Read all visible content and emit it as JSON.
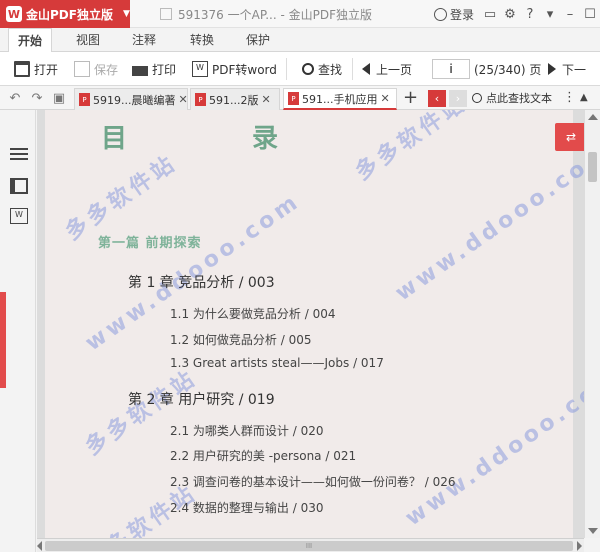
{
  "app": {
    "logo_text": "W",
    "name": "金山PDF独立版",
    "doc_title": "591376 一个AP... - 金山PDF独立版",
    "login_label": "登录"
  },
  "menu": {
    "tabs": [
      "开始",
      "视图",
      "注释",
      "转换",
      "保护"
    ],
    "active": "开始"
  },
  "toolbar": {
    "open": "打开",
    "save": "保存",
    "print": "打印",
    "pdf_to_word": "PDF转word",
    "find": "查找",
    "prev_page": "上一页",
    "page_value": "i",
    "page_count": "(25/340) 页",
    "next_page": "下一"
  },
  "doc_tabs": [
    {
      "label": "5919...晨曦编著",
      "icon": "pdf-icon"
    },
    {
      "label": "591...2版",
      "icon": "pdf-icon"
    },
    {
      "label": "591...手机应用",
      "icon": "pdf-icon"
    }
  ],
  "find_text": "点此查找文本",
  "colors": {
    "accent": "#d63a3a",
    "toc_green": "#6fa58a",
    "watermark": "#7a8cdc"
  },
  "document": {
    "toc_title": "目 录",
    "part": "第一篇 前期探索",
    "entries": [
      {
        "type": "chapter",
        "text": "第 1 章  竞品分析   /   003"
      },
      {
        "type": "section",
        "text": "1.1   为什么要做竞品分析   /   004"
      },
      {
        "type": "section",
        "text": "1.2   如何做竞品分析   /   005"
      },
      {
        "type": "section",
        "text": "1.3   Great artists steal——Jobs   /   017"
      },
      {
        "type": "chapter",
        "text": "第 2 章  用户研究   /   019"
      },
      {
        "type": "section",
        "text": "2.1   为哪类人群而设计   /   020"
      },
      {
        "type": "section",
        "text": "2.2   用户研究的美 -persona   /   021"
      },
      {
        "type": "section",
        "text": "2.3   调查问卷的基本设计——如何做一份问卷？   /   026"
      },
      {
        "type": "section",
        "text": "2.4   数据的整理与输出   /   030"
      }
    ],
    "watermarks": [
      "多多软件站",
      "www.ddooo.com",
      "多多软件站",
      "www.ddooo.com",
      "多多软件站",
      "www.ddooo.com",
      "多多软件站"
    ]
  },
  "scrollbar": {
    "h_grip": "III"
  }
}
